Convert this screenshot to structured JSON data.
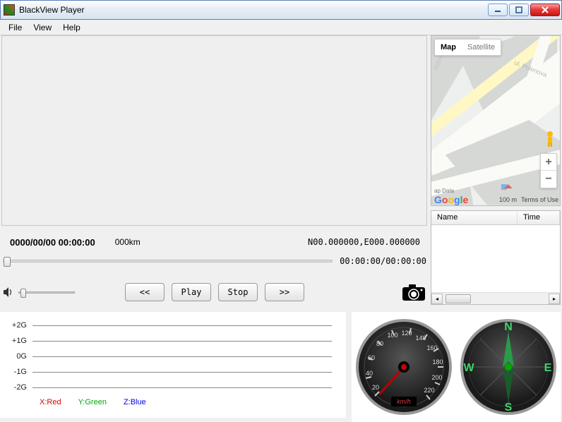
{
  "title": "BlackView Player",
  "menu": {
    "file": "File",
    "view": "View",
    "help": "Help"
  },
  "playback": {
    "timestamp": "0000/00/00 00:00:00",
    "distance": "000km",
    "coords": "N00.000000,E000.000000",
    "seek_time": "00:00:00/00:00:00"
  },
  "controls": {
    "rewind": "<<",
    "play": "Play",
    "stop": "Stop",
    "forward": ">>"
  },
  "map": {
    "type_map": "Map",
    "type_sat": "Satellite",
    "street1": "ul. Polenova",
    "street2": "Stilova",
    "scale": "100 m",
    "terms": "Terms of Use",
    "data": "ap Data"
  },
  "filelist": {
    "col_name": "Name",
    "col_time": "Time"
  },
  "gsensor": {
    "labels": [
      "+2G",
      "+1G",
      "0G",
      "-1G",
      "-2G"
    ],
    "legend_x": "X:Red",
    "legend_y": "Y:Green",
    "legend_z": "Z:Blue"
  },
  "speedo": {
    "ticks": [
      "20",
      "40",
      "60",
      "80",
      "100",
      "120",
      "140",
      "160",
      "180",
      "200",
      "220"
    ],
    "unit": "km/h"
  },
  "compass": {
    "n": "N",
    "e": "E",
    "s": "S",
    "w": "W"
  }
}
